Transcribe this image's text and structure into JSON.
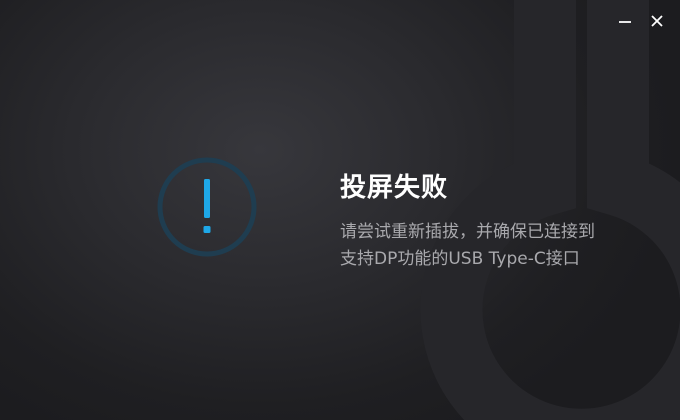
{
  "window": {
    "minimize_label": "minimize",
    "close_label": "close"
  },
  "status": {
    "icon": "exclamation-circle-icon",
    "title": "投屏失败",
    "message_line1": "请尝试重新插拔，并确保已连接到",
    "message_line2": "支持DP功能的USB Type-C接口"
  },
  "colors": {
    "accent": "#1ea8e8",
    "ring": "#1f3d50",
    "title": "#ffffff",
    "message": "#a9a9ad"
  }
}
